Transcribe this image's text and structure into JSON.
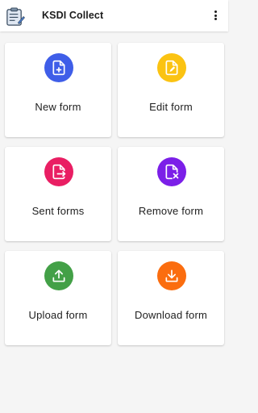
{
  "app": {
    "title": "KSDI Collect",
    "logo_icon": "clipboard-form-icon",
    "menu_icon": "more-vert-icon"
  },
  "cards": [
    {
      "label": "New form",
      "icon": "file-plus-icon",
      "color": "#3f5ee8"
    },
    {
      "label": "Edit form",
      "icon": "file-edit-icon",
      "color": "#fbc312"
    },
    {
      "label": "Sent forms",
      "icon": "file-export-icon",
      "color": "#e91e63"
    },
    {
      "label": "Remove form",
      "icon": "file-remove-icon",
      "color": "#7b1fe8"
    },
    {
      "label": "Upload form",
      "icon": "upload-icon",
      "color": "#43a047"
    },
    {
      "label": "Download form",
      "icon": "download-icon",
      "color": "#fb6d0f"
    }
  ]
}
